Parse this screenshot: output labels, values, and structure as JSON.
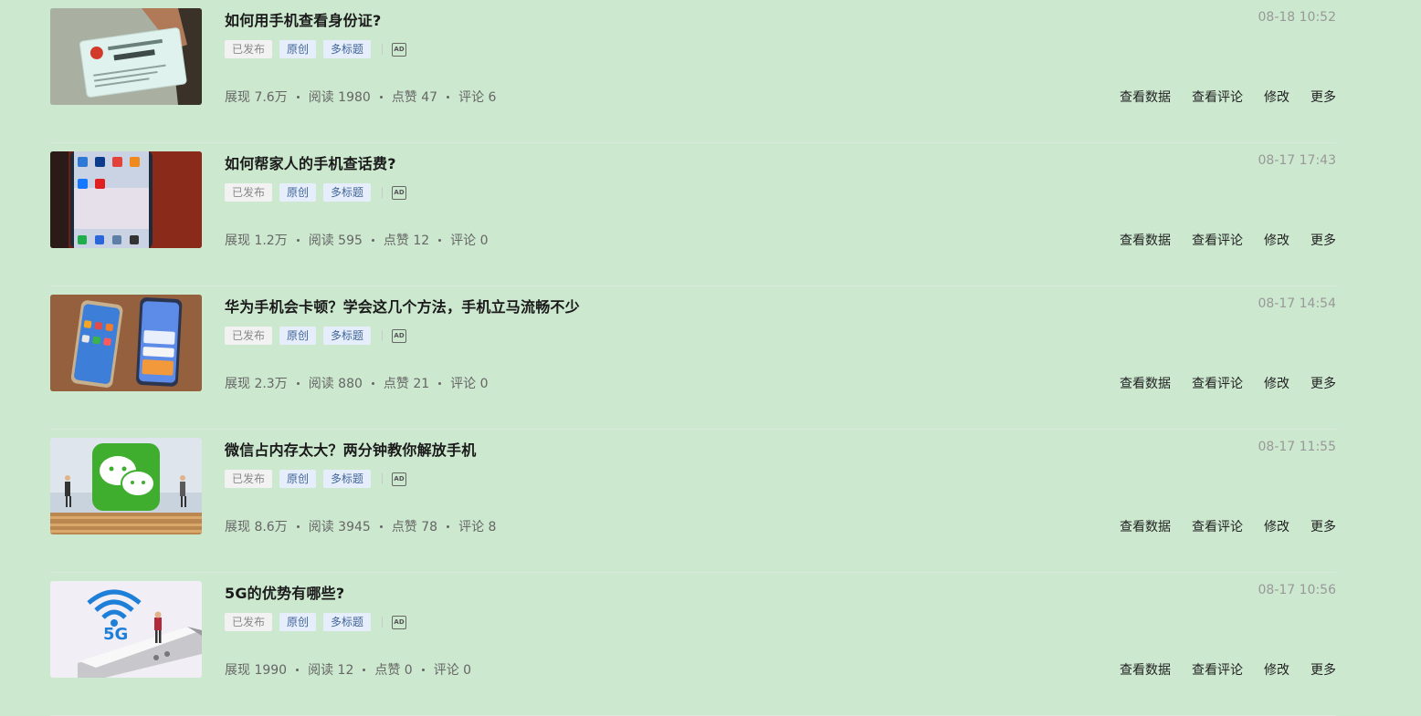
{
  "articles": [
    {
      "title": "如何用手机查看身份证?",
      "date": "08-18 10:52",
      "tags": [
        "已发布",
        "原创",
        "多标题"
      ],
      "ad_label": "AD",
      "stats": [
        "展现 7.6万",
        "阅读 1980",
        "点赞 47",
        "评论 6"
      ],
      "actions": [
        "查看数据",
        "查看评论",
        "修改",
        "更多"
      ]
    },
    {
      "title": "如何帮家人的手机查话费?",
      "date": "08-17 17:43",
      "tags": [
        "已发布",
        "原创",
        "多标题"
      ],
      "ad_label": "AD",
      "stats": [
        "展现 1.2万",
        "阅读 595",
        "点赞 12",
        "评论 0"
      ],
      "actions": [
        "查看数据",
        "查看评论",
        "修改",
        "更多"
      ]
    },
    {
      "title": "华为手机会卡顿？学会这几个方法，手机立马流畅不少",
      "date": "08-17 14:54",
      "tags": [
        "已发布",
        "原创",
        "多标题"
      ],
      "ad_label": "AD",
      "stats": [
        "展现 2.3万",
        "阅读 880",
        "点赞 21",
        "评论 0"
      ],
      "actions": [
        "查看数据",
        "查看评论",
        "修改",
        "更多"
      ]
    },
    {
      "title": "微信占内存太大？两分钟教你解放手机",
      "date": "08-17 11:55",
      "tags": [
        "已发布",
        "原创",
        "多标题"
      ],
      "ad_label": "AD",
      "stats": [
        "展现 8.6万",
        "阅读 3945",
        "点赞 78",
        "评论 8"
      ],
      "actions": [
        "查看数据",
        "查看评论",
        "修改",
        "更多"
      ]
    },
    {
      "title": "5G的优势有哪些?",
      "date": "08-17 10:56",
      "tags": [
        "已发布",
        "原创",
        "多标题"
      ],
      "ad_label": "AD",
      "stats": [
        "展现 1990",
        "阅读 12",
        "点赞 0",
        "评论 0"
      ],
      "actions": [
        "查看数据",
        "查看评论",
        "修改",
        "更多"
      ]
    }
  ],
  "thumbnails": [
    {
      "label": "id-card-photo",
      "bg": "#8f9f8a"
    },
    {
      "label": "phone-apps-photo",
      "bg": "#7a2418"
    },
    {
      "label": "two-phones-photo",
      "bg": "#8a5a3a"
    },
    {
      "label": "wechat-logo-photo",
      "bg": "#dfe6ef",
      "accent": "#3fb035"
    },
    {
      "label": "5g-phone-photo",
      "bg": "#f2f0f6",
      "accent": "#2b7fd6",
      "text": "5G"
    }
  ]
}
